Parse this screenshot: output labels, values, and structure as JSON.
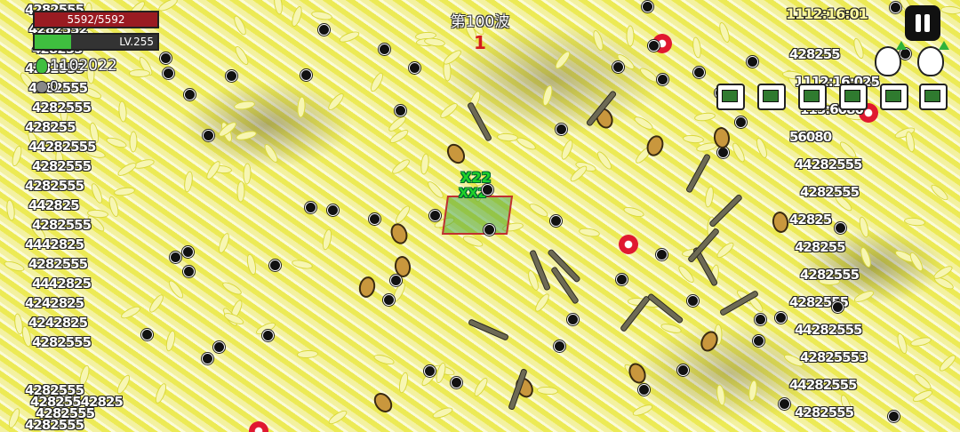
{
  "hud": {
    "hp_text": "5592/5592",
    "hp_fraction": 1.0,
    "level_text": "LV.255",
    "xp_fraction": 0.3,
    "gems": "1102022",
    "coins": "0",
    "wave": "第100波",
    "kill_counter": "1",
    "timer": "1112:16:01"
  },
  "hero": {
    "multiplier_top": "X22",
    "multiplier_bottom": "XX2"
  },
  "damage_left": [
    "4282555",
    "4282552",
    "428255",
    "4282555",
    "4282555",
    "4282555",
    "428255",
    "44282555",
    "4282555",
    "4282555",
    "442825",
    "4282555",
    "4442825",
    "4282555",
    "4442825",
    "4242825",
    "4242825",
    "4282555"
  ],
  "damage_bottom_left": [
    "4282555",
    "42825542825",
    "4282555",
    "4282555"
  ],
  "damage_right": [
    "428255",
    "1112:16:025",
    "115:6080",
    "56080",
    "44282555",
    "4282555",
    "42825",
    "428255",
    "4282555",
    "4282555",
    "44282555",
    "42825553",
    "44282555",
    "4282555"
  ],
  "icons": {
    "pause": "pause-icon",
    "gem": "green-gem-icon",
    "coin": "coin-icon",
    "skill": "green-chest-skill-icon",
    "egg": "egg-upgrade-icon"
  },
  "colors": {
    "hp_bar": "#9a1b22",
    "xp_bar": "#3fbf3f",
    "kill_counter": "#d41b1b",
    "hero_tag": "#1fd32a"
  }
}
